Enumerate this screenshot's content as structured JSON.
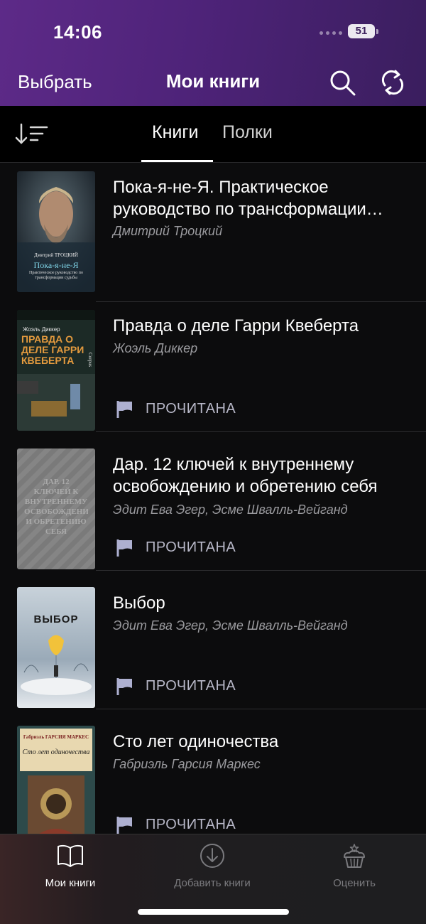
{
  "status_bar": {
    "time": "14:06",
    "battery": "51"
  },
  "nav": {
    "select_label": "Выбрать",
    "title": "Мои книги"
  },
  "tabs": [
    {
      "label": "Книги"
    },
    {
      "label": "Полки"
    }
  ],
  "books": [
    {
      "title": "Пока-я-не-Я. Практическое руководство по трансформации судьбы",
      "author": "Дмитрий Троцкий",
      "status": ""
    },
    {
      "title": "Правда о деле Гарри Квеберта",
      "author": "Жоэль Диккер",
      "status": "ПРОЧИТАНА"
    },
    {
      "title": "Дар. 12 ключей к внутреннему освобождению и обретению себя",
      "author": "Эдит Ева Эгер, Эсме Швалль-Вейганд",
      "status": "ПРОЧИТАНА"
    },
    {
      "title": "Выбор",
      "author": "Эдит Ева Эгер, Эсме Швалль-Вейганд",
      "status": "ПРОЧИТАНА"
    },
    {
      "title": "Сто лет одиночества",
      "author": "Габриэль Гарсия Маркес",
      "status": "ПРОЧИТАНА"
    }
  ],
  "covers": [
    {
      "author": "Дмитрий ТРОЦКИЙ",
      "title": "Пока-я-не-Я",
      "subtitle": "Практическое руководство по трансформации судьбы"
    },
    {
      "author": "Жоэль Диккер",
      "title": "ПРАВДА О ДЕЛЕ ГАРРИ КВЕБЕРТА",
      "publisher": "Corpus"
    },
    {
      "text": "ДАР. 12 КЛЮЧЕЙ К ВНУТРЕННЕМУ ОСВОБОЖДЕНИЮ И ОБРЕТЕНИЮ СЕБЯ"
    },
    {
      "title": "ВЫБОР"
    },
    {
      "author": "Габриэль ГАРСИЯ МАРКЕС",
      "title": "Сто лет одиночества"
    }
  ],
  "bottom_tabs": [
    {
      "label": "Мои книги",
      "icon": "open-book-icon",
      "active": true
    },
    {
      "label": "Добавить книги",
      "icon": "download-icon",
      "active": false
    },
    {
      "label": "Оценить",
      "icon": "cupcake-icon",
      "active": false
    }
  ],
  "colors": {
    "header": "#4e2379",
    "background": "#0c0c0d",
    "status_flag": "#aeb0d0"
  }
}
